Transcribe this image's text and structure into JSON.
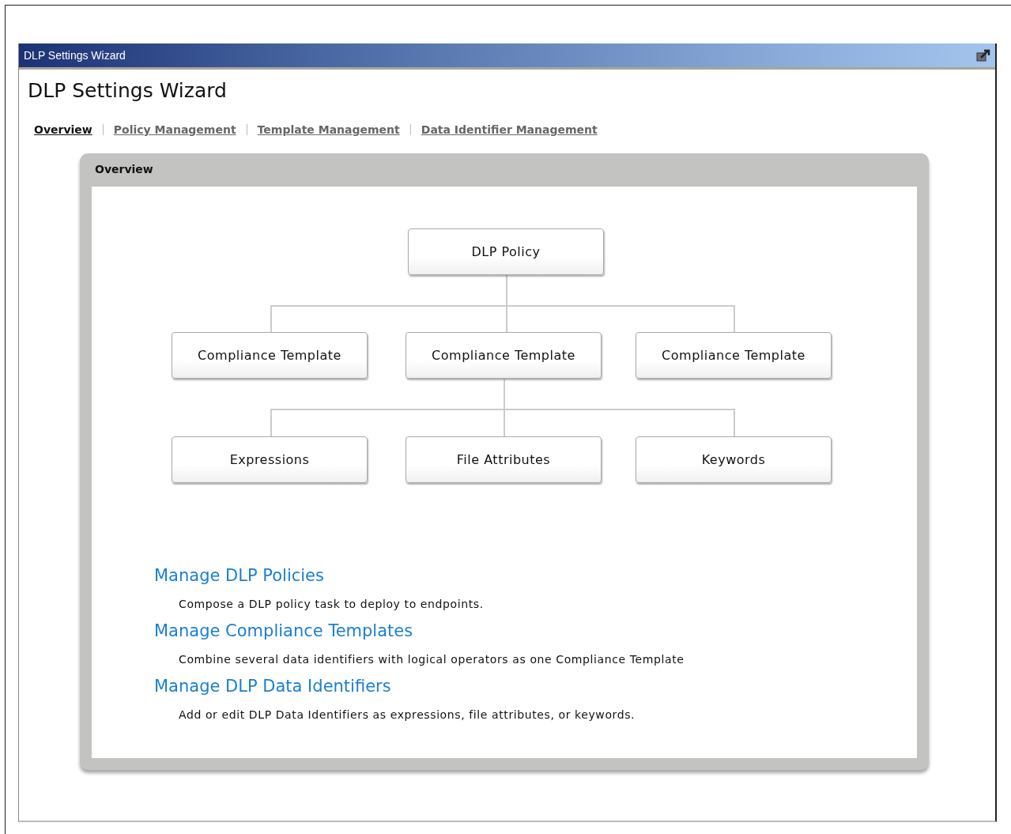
{
  "window": {
    "title": "DLP Settings Wizard"
  },
  "page_title": "DLP Settings Wizard",
  "tabs": [
    {
      "label": "Overview",
      "selected": true
    },
    {
      "label": "Policy Management",
      "selected": false
    },
    {
      "label": "Template Management",
      "selected": false
    },
    {
      "label": "Data Identifier Management",
      "selected": false
    }
  ],
  "panel": {
    "title": "Overview",
    "diagram": {
      "root": "DLP Policy",
      "templates": [
        "Compliance Template",
        "Compliance Template",
        "Compliance Template"
      ],
      "identifiers": [
        "Expressions",
        "File Attributes",
        "Keywords"
      ]
    },
    "sections": [
      {
        "link": "Manage DLP Policies",
        "description": "Compose a DLP policy task to deploy to endpoints."
      },
      {
        "link": "Manage Compliance Templates",
        "description": "Combine several data identifiers with logical operators as one Compliance Template"
      },
      {
        "link": "Manage DLP Data Identifiers",
        "description": "Add or edit DLP Data Identifiers as expressions, file attributes, or keywords."
      }
    ]
  }
}
